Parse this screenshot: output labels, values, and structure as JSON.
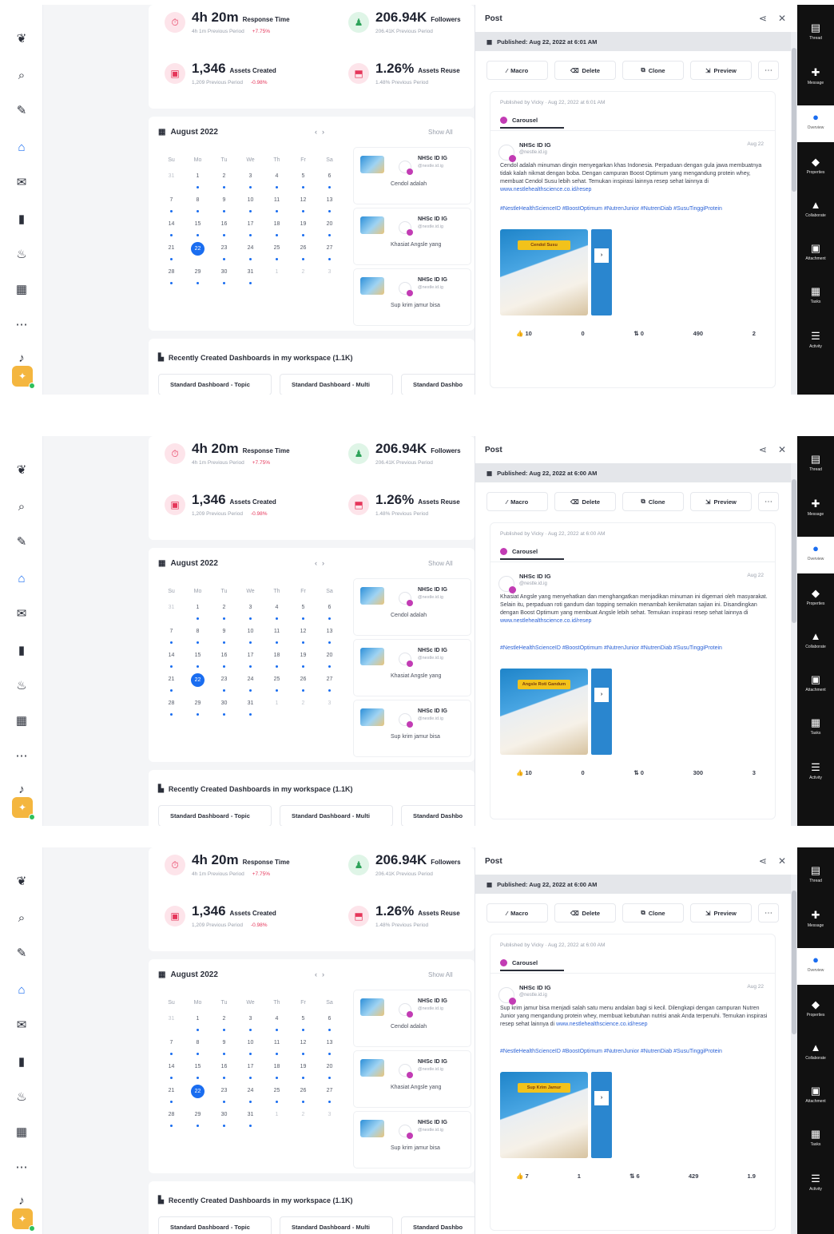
{
  "rail_icons": [
    "brand-logo-icon",
    "search-icon",
    "compose-icon",
    "home-icon",
    "inbox-icon",
    "analytics-icon",
    "flame-icon",
    "calendar-icon",
    "more-icon",
    "bell-icon"
  ],
  "colors": {
    "accent": "#1a6df0",
    "pink": "#e5365a",
    "green": "#2ea35a",
    "carousel": "#c23cb4",
    "dark_rail": "#111111"
  },
  "stats": {
    "response_time": {
      "value": "4h 20m",
      "label": "Response Time",
      "sub": "4h 1m Previous Period",
      "delta": "+7.75%"
    },
    "followers": {
      "value": "206.94K",
      "label": "Followers",
      "sub": "206.41K Previous Period"
    },
    "assets": {
      "value": "1,346",
      "label": "Assets Created",
      "sub": "1,209 Previous Period",
      "delta": "-0.98%"
    },
    "assets_reused": {
      "value": "1.26%",
      "label": "Assets Reuse",
      "sub": "1.48% Previous Period"
    }
  },
  "calendar": {
    "month": "August 2022",
    "show_all": "Show All",
    "weekdays": [
      "Su",
      "Mo",
      "Tu",
      "We",
      "Th",
      "Fr",
      "Sa"
    ],
    "weeks": [
      [
        "31",
        "1",
        "2",
        "3",
        "4",
        "5",
        "6"
      ],
      [
        "7",
        "8",
        "9",
        "10",
        "11",
        "12",
        "13"
      ],
      [
        "14",
        "15",
        "16",
        "17",
        "18",
        "19",
        "20"
      ],
      [
        "21",
        "22",
        "23",
        "24",
        "25",
        "26",
        "27"
      ],
      [
        "28",
        "29",
        "30",
        "31",
        "1",
        "2",
        "3"
      ]
    ],
    "today": "22"
  },
  "posts_list": [
    {
      "name": "NHSc ID IG",
      "handle": "@nestle.id.ig",
      "text": "Cendol adalah"
    },
    {
      "name": "NHSc ID IG",
      "handle": "@nestle.id.ig",
      "text": "Khasiat Angsle yang"
    },
    {
      "name": "NHSc ID IG",
      "handle": "@nestle.id.ig",
      "text": "Sup krim jamur bisa"
    }
  ],
  "dashboards": {
    "title": "Recently Created Dashboards in my workspace (1.1K)",
    "items": [
      "Standard Dashboard - Topic",
      "Standard Dashboard - Multi",
      "Standard Dashbo"
    ]
  },
  "panel": {
    "title": "Post",
    "toolbar": [
      "Macro",
      "Delete",
      "Clone",
      "Preview"
    ],
    "type_label": "Carousel",
    "author": "NHSc ID IG",
    "handle": "@nestle.id.ig",
    "date": "Aug 22"
  },
  "frames": [
    {
      "published": "Published: Aug 22, 2022 at 6:01 AM",
      "meta": "Published by Vicky · Aug 22, 2022 at 6:01 AM",
      "body": "Cendol adalah minuman dingin menyegarkan khas Indonesia. Perpaduan dengan gula jawa membuatnya tidak kalah nikmat dengan boba. Dengan campuran Boost Optimum yang mengandung protein whey, membuat Cendol Susu lebih sehat. Temukan inspirasi lainnya resep sehat lainnya di",
      "link": "www.nestlehealthscience.co.id/resep",
      "tags": "#NestleHealthScienceID #BoostOptimum #NutrenJunior #NutrenDiab #SusuTinggiProtein",
      "image_label": "Cendol Susu",
      "stats": [
        "10",
        "0",
        "0",
        "490",
        "2"
      ]
    },
    {
      "published": "Published: Aug 22, 2022 at 6:00 AM",
      "meta": "Published by Vicky · Aug 22, 2022 at 6:00 AM",
      "body": "Khasiat Angsle yang menyehatkan dan menghangatkan menjadikan minuman ini digemari oleh masyarakat. Selain itu, perpaduan roti gandum dan topping semakin menambah kenikmatan sajian ini. Disandingkan dengan Boost Optimum yang membuat Angsle lebih sehat. Temukan inspirasi resep sehat lainnya di",
      "link": "www.nestlehealthscience.co.id/resep",
      "tags": "#NestleHealthScienceID #BoostOptimum #NutrenJunior #NutrenDiab #SusuTinggiProtein",
      "image_label": "Angsle Roti Gandum",
      "stats": [
        "10",
        "0",
        "0",
        "300",
        "3"
      ]
    },
    {
      "published": "Published: Aug 22, 2022 at 6:00 AM",
      "meta": "Published by Vicky · Aug 22, 2022 at 6:00 AM",
      "body": "Sup krim jamur bisa menjadi salah satu menu andalan bagi si kecil. Dilengkapi dengan campuran Nutren Junior yang mengandung protein whey, membuat kebutuhan nutrisi anak Anda terpenuhi. Temukan inspirasi resep sehat lainnya di",
      "link": "www.nestlehealthscience.co.id/resep",
      "tags": "#NestleHealthScienceID #BoostOptimum #NutrenJunior #NutrenDiab #SusuTinggiProtein",
      "image_label": "Sup Krim Jamur",
      "stats": [
        "7",
        "1",
        "6",
        "429",
        "1.9"
      ]
    }
  ],
  "right_rail": [
    "Thread",
    "Message",
    "Overview",
    "Properties",
    "Collaborate",
    "Attachment",
    "Tasks",
    "Activity"
  ]
}
